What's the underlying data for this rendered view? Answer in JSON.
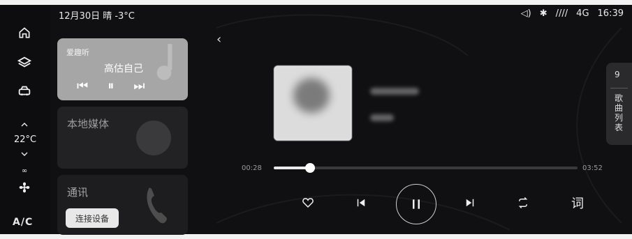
{
  "status": {
    "datetime_weather": "12月30日 晴 -3°C",
    "network": "4G",
    "time": "16:39"
  },
  "rail": {
    "temperature": "22°C",
    "ac_label": "A/C"
  },
  "cards": {
    "music": {
      "app_name": "爱趣听",
      "song_title": "高估自己"
    },
    "local_media": {
      "title": "本地媒体"
    },
    "call": {
      "title": "通讯",
      "connect_button": "连接设备"
    }
  },
  "player": {
    "elapsed": "00:28",
    "duration": "03:52",
    "progress": 0.12,
    "lyrics_label": "词"
  },
  "playlist_tab": {
    "count": "9",
    "label": "歌曲列表"
  },
  "colors": {
    "accent": "#ffffff",
    "card_highlight": "#a6a6a6"
  },
  "icons": [
    "home-icon",
    "layers-icon",
    "car-icon",
    "chevron-up-icon",
    "chevron-down-icon",
    "fan-icon",
    "back-icon",
    "heart-icon",
    "previous-icon",
    "pause-icon",
    "next-icon",
    "repeat-icon",
    "bluetooth-icon",
    "volume-icon",
    "signal-icon"
  ]
}
